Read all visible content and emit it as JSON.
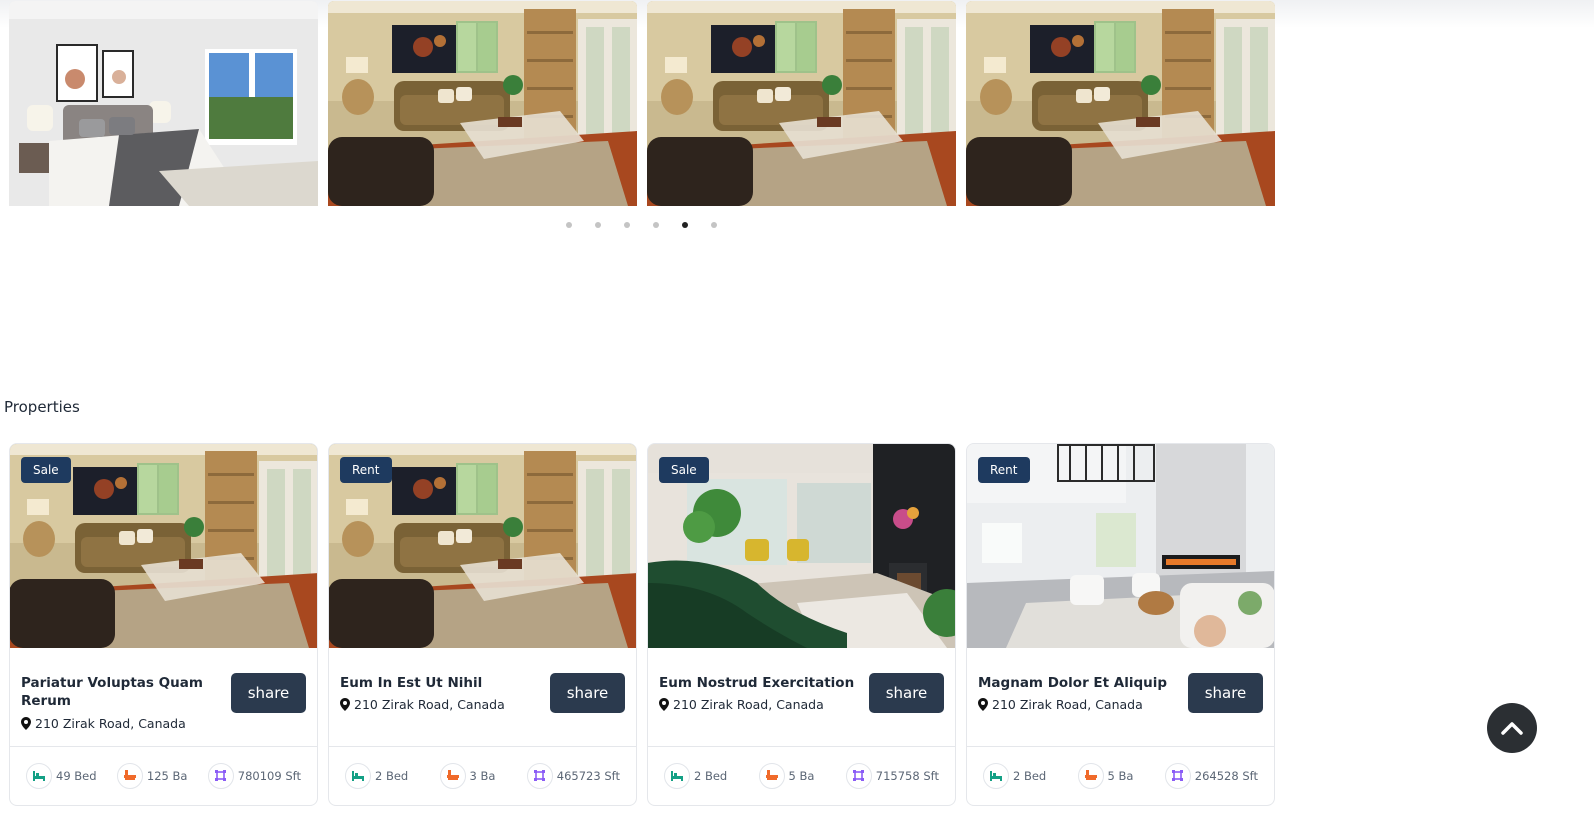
{
  "carousel": {
    "slides": [
      {
        "scene": "bedroom-photo"
      },
      {
        "scene": "living-room-photo"
      },
      {
        "scene": "living-room-photo"
      },
      {
        "scene": "living-room-photo"
      }
    ],
    "dots_count": 6,
    "active_dot": 4
  },
  "section": {
    "title": "Properties"
  },
  "properties": [
    {
      "badge": "Sale",
      "title": "Pariatur Voluptas Quam Rerum",
      "address": "210 Zirak Road, Canada",
      "share_label": "share",
      "beds": "49 Bed",
      "baths": "125 Ba",
      "area": "780109 Sft",
      "scene": "living-room-photo"
    },
    {
      "badge": "Rent",
      "title": "Eum In Est Ut Nihil",
      "address": "210 Zirak Road, Canada",
      "share_label": "share",
      "beds": "2 Bed",
      "baths": "3 Ba",
      "area": "465723 Sft",
      "scene": "living-room-photo"
    },
    {
      "badge": "Sale",
      "title": "Eum Nostrud Exercitation",
      "address": "210 Zirak Road, Canada",
      "share_label": "share",
      "beds": "2 Bed",
      "baths": "5 Ba",
      "area": "715758 Sft",
      "scene": "green-sofa-room-photo"
    },
    {
      "badge": "Rent",
      "title": "Magnam Dolor Et Aliquip",
      "address": "210 Zirak Road, Canada",
      "share_label": "share",
      "beds": "2 Bed",
      "baths": "5 Ba",
      "area": "264528 Sft",
      "scene": "white-living-room-photo"
    }
  ],
  "colors": {
    "badge_bg": "#1e3a5f",
    "share_bg": "#2b3a4e",
    "bed_icon": "#14a085",
    "bath_icon": "#f06a2a",
    "area_icon": "#8b5cf6",
    "scroll_top_bg": "#2b2f33"
  },
  "icons": {
    "bed": "bed-icon",
    "bath": "bath-icon",
    "area": "area-icon",
    "location": "map-pin-icon",
    "scroll_top": "chevron-up-icon"
  }
}
